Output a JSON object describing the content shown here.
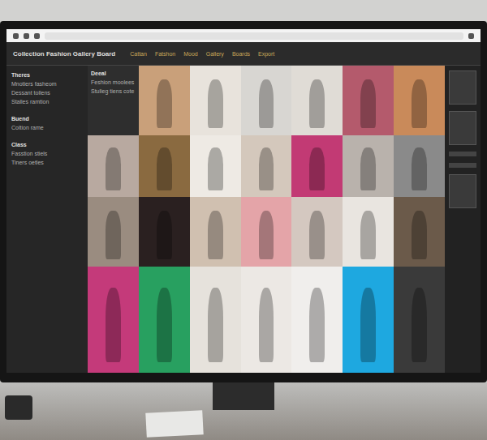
{
  "title": "Collection Fashion Gallery Board",
  "toolbar_items": [
    "Cattan",
    "Fatshon",
    "Mood",
    "Gallery",
    "Boards",
    "Export"
  ],
  "left_panel": {
    "sections": [
      {
        "heading": "Theres",
        "lines": [
          "Mnotiers fasheom",
          "Dessant tollens",
          "Stalles ramtion"
        ]
      },
      {
        "heading": "Buend",
        "lines": [
          "Coltion rame"
        ]
      },
      {
        "heading": "Class",
        "lines": [
          "Fasstion stiels",
          "Tiners oetles"
        ]
      }
    ]
  },
  "info_card": {
    "heading": "Deeal",
    "lines": [
      "Feshion moolees",
      "Stulieg tiens cote"
    ]
  },
  "photos": [
    {
      "color": "#c9a07a"
    },
    {
      "color": "#e8e3dc"
    },
    {
      "color": "#d8d6d2"
    },
    {
      "color": "#e0dcd6"
    },
    {
      "color": "#b45a6c"
    },
    {
      "color": "#c98a5a"
    },
    {
      "color": "#b8a9a0"
    },
    {
      "color": "#8a6a40"
    },
    {
      "color": "#eeeae4"
    },
    {
      "color": "#d4c8bc"
    },
    {
      "color": "#c23a74"
    },
    {
      "color": "#b9b2ac"
    },
    {
      "color": "#8a8a8a"
    },
    {
      "color": "#9a8c80"
    },
    {
      "color": "#2a2020"
    },
    {
      "color": "#d0c0b0"
    },
    {
      "color": "#e4a4a8"
    },
    {
      "color": "#d4c8c0"
    },
    {
      "color": "#e9e5e0"
    },
    {
      "color": "#6b5a4a"
    },
    {
      "color": "#c43a7a"
    },
    {
      "color": "#28a060"
    },
    {
      "color": "#e6e2dc"
    },
    {
      "color": "#ece8e4"
    },
    {
      "color": "#f0eeec"
    },
    {
      "color": "#1ea8e0"
    },
    {
      "color": "#3a3a3a"
    }
  ]
}
